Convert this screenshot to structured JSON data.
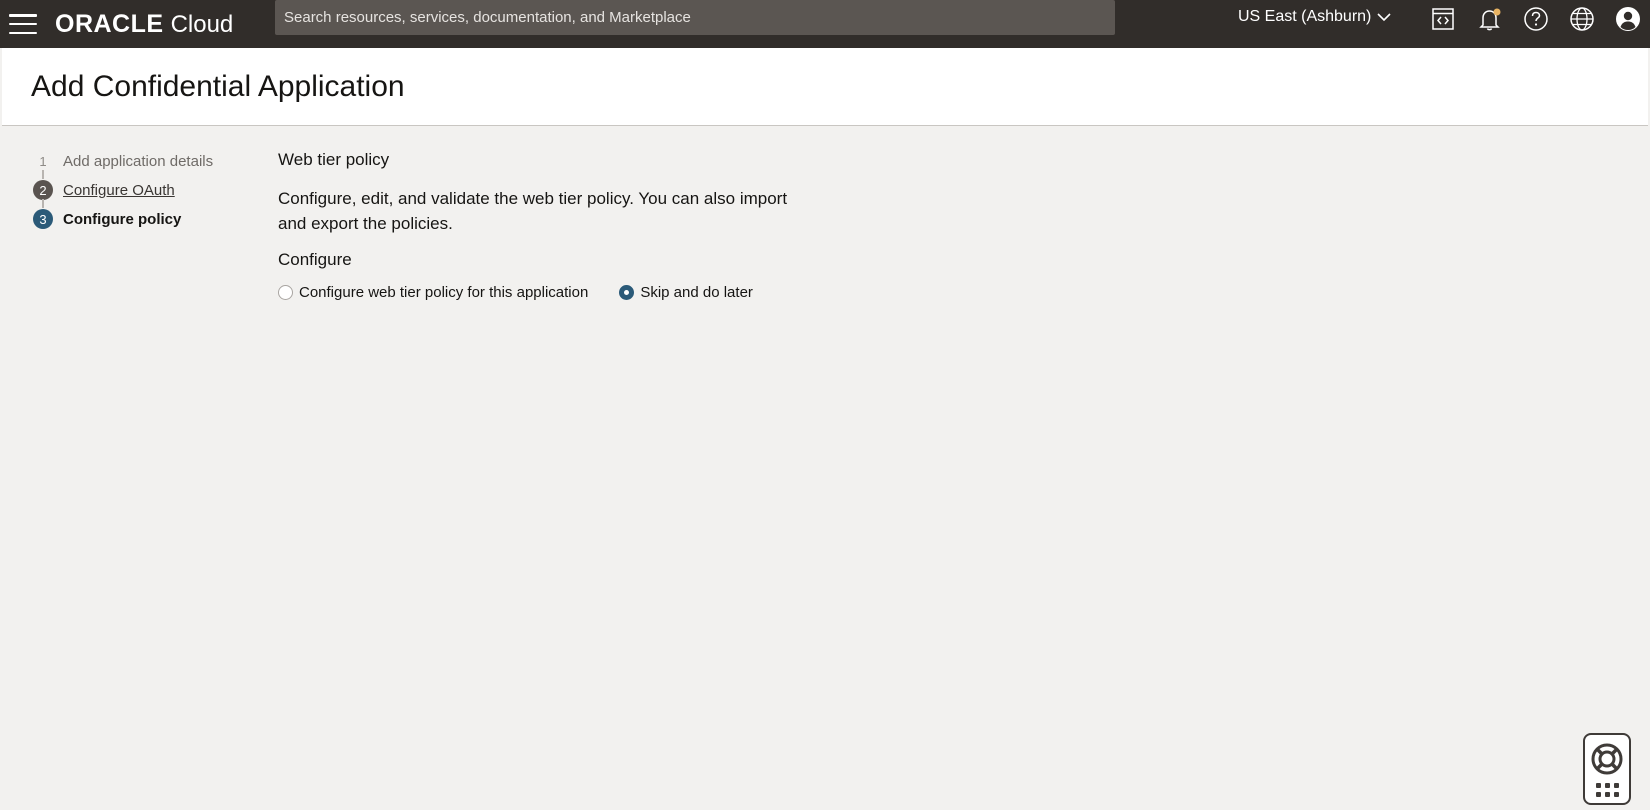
{
  "topbar": {
    "brand": "ORACLE",
    "product": "Cloud",
    "search_placeholder": "Search resources, services, documentation, and Marketplace",
    "region": "US East (Ashburn)",
    "icons": [
      "menu-icon",
      "code-editor-icon",
      "bell-icon",
      "help-icon",
      "globe-icon",
      "profile-icon"
    ]
  },
  "page": {
    "title": "Add Confidential Application"
  },
  "steps": [
    {
      "number": "1",
      "label": "Add application details",
      "state": "completed"
    },
    {
      "number": "2",
      "label": "Configure OAuth",
      "state": "visited"
    },
    {
      "number": "3",
      "label": "Configure policy",
      "state": "current"
    }
  ],
  "content": {
    "section_title": "Web tier policy",
    "description": "Configure, edit, and validate the web tier policy. You can also import and export the policies.",
    "configure_label": "Configure",
    "radio_options": [
      {
        "label": "Configure web tier policy for this application",
        "checked": false
      },
      {
        "label": "Skip and do later",
        "checked": true
      }
    ]
  },
  "colors": {
    "topbar_bg": "#312d2a",
    "accent": "#2b5a78",
    "page_bg": "#f2f1ef",
    "notification_dot": "#e9b463"
  }
}
